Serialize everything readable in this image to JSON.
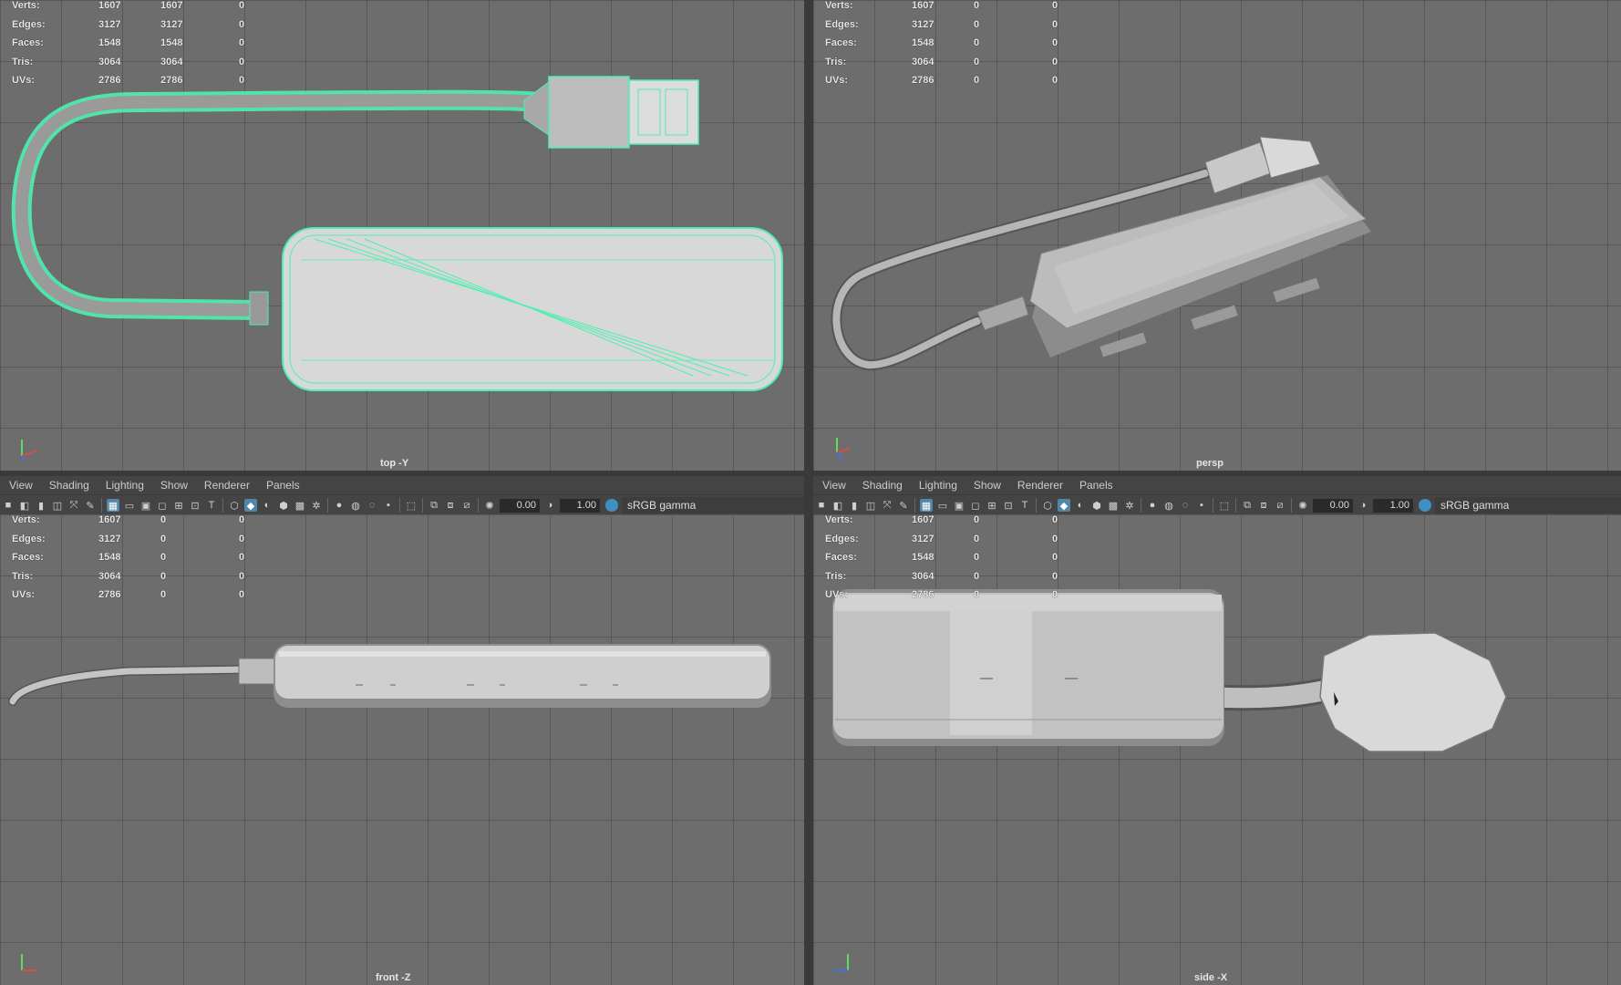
{
  "colors": {
    "viewport_bg": "#6d6d6d",
    "wire": "#4cf0b0",
    "accent": "#5285a6"
  },
  "menu": {
    "view": "View",
    "shading": "Shading",
    "lighting": "Lighting",
    "show": "Show",
    "renderer": "Renderer",
    "panels": "Panels"
  },
  "toolbar": {
    "exposure": "0.00",
    "gamma": "1.00",
    "colorspace": "sRGB gamma"
  },
  "hud_labels": {
    "verts": "Verts:",
    "edges": "Edges:",
    "faces": "Faces:",
    "tris": "Tris:",
    "uvs": "UVs:"
  },
  "viewports": {
    "top": {
      "camera": "top -Y",
      "stats": [
        [
          "1607",
          "1607",
          "0"
        ],
        [
          "3127",
          "3127",
          "0"
        ],
        [
          "1548",
          "1548",
          "0"
        ],
        [
          "3064",
          "3064",
          "0"
        ],
        [
          "2786",
          "2786",
          "0"
        ]
      ]
    },
    "persp": {
      "camera": "persp",
      "stats": [
        [
          "1607",
          "0",
          "0"
        ],
        [
          "3127",
          "0",
          "0"
        ],
        [
          "1548",
          "0",
          "0"
        ],
        [
          "3064",
          "0",
          "0"
        ],
        [
          "2786",
          "0",
          "0"
        ]
      ]
    },
    "front": {
      "camera": "front -Z",
      "stats": [
        [
          "1607",
          "0",
          "0"
        ],
        [
          "3127",
          "0",
          "0"
        ],
        [
          "1548",
          "0",
          "0"
        ],
        [
          "3064",
          "0",
          "0"
        ],
        [
          "2786",
          "0",
          "0"
        ]
      ]
    },
    "side": {
      "camera": "side -X",
      "stats": [
        [
          "1607",
          "0",
          "0"
        ],
        [
          "3127",
          "0",
          "0"
        ],
        [
          "1548",
          "0",
          "0"
        ],
        [
          "3064",
          "0",
          "0"
        ],
        [
          "2786",
          "0",
          "0"
        ]
      ]
    }
  },
  "icons": {
    "axis": "axis-gizmo-icon",
    "gamma": "color-management-icon"
  }
}
